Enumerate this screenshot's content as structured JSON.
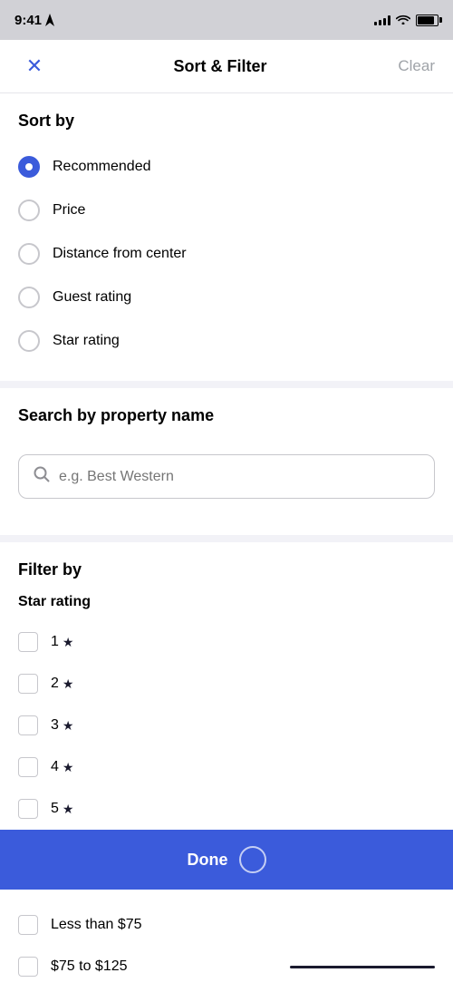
{
  "statusBar": {
    "time": "9:41",
    "hasNavArrow": true
  },
  "header": {
    "title": "Sort & Filter",
    "clearLabel": "Clear",
    "closeIcon": "✕"
  },
  "sortBy": {
    "sectionTitle": "Sort by",
    "options": [
      {
        "id": "recommended",
        "label": "Recommended",
        "selected": true
      },
      {
        "id": "price",
        "label": "Price",
        "selected": false
      },
      {
        "id": "distance",
        "label": "Distance from center",
        "selected": false
      },
      {
        "id": "guest-rating",
        "label": "Guest rating",
        "selected": false
      },
      {
        "id": "star-rating",
        "label": "Star rating",
        "selected": false
      }
    ]
  },
  "searchByProperty": {
    "sectionTitle": "Search by property name",
    "placeholder": "e.g. Best Western",
    "searchIcon": "🔍"
  },
  "filterBy": {
    "sectionTitle": "Filter by",
    "starRating": {
      "subsectionTitle": "Star rating",
      "options": [
        {
          "id": "1star",
          "label": "1",
          "stars": 1
        },
        {
          "id": "2star",
          "label": "2",
          "stars": 2
        },
        {
          "id": "3star",
          "label": "3",
          "stars": 3
        },
        {
          "id": "4star",
          "label": "4",
          "stars": 4
        },
        {
          "id": "5star",
          "label": "5",
          "stars": 5
        }
      ]
    }
  },
  "doneButton": {
    "label": "Done"
  },
  "priceFilter": {
    "options": [
      {
        "id": "less-than-75",
        "label": "Less than $75"
      },
      {
        "id": "75-to-125",
        "label": "$75 to $125",
        "hasBar": true
      }
    ]
  },
  "colors": {
    "accent": "#3b5bdb",
    "border": "#c7c7cc",
    "text": "#000000",
    "mutedText": "#8e8e93",
    "clearText": "#9fa3a8"
  }
}
